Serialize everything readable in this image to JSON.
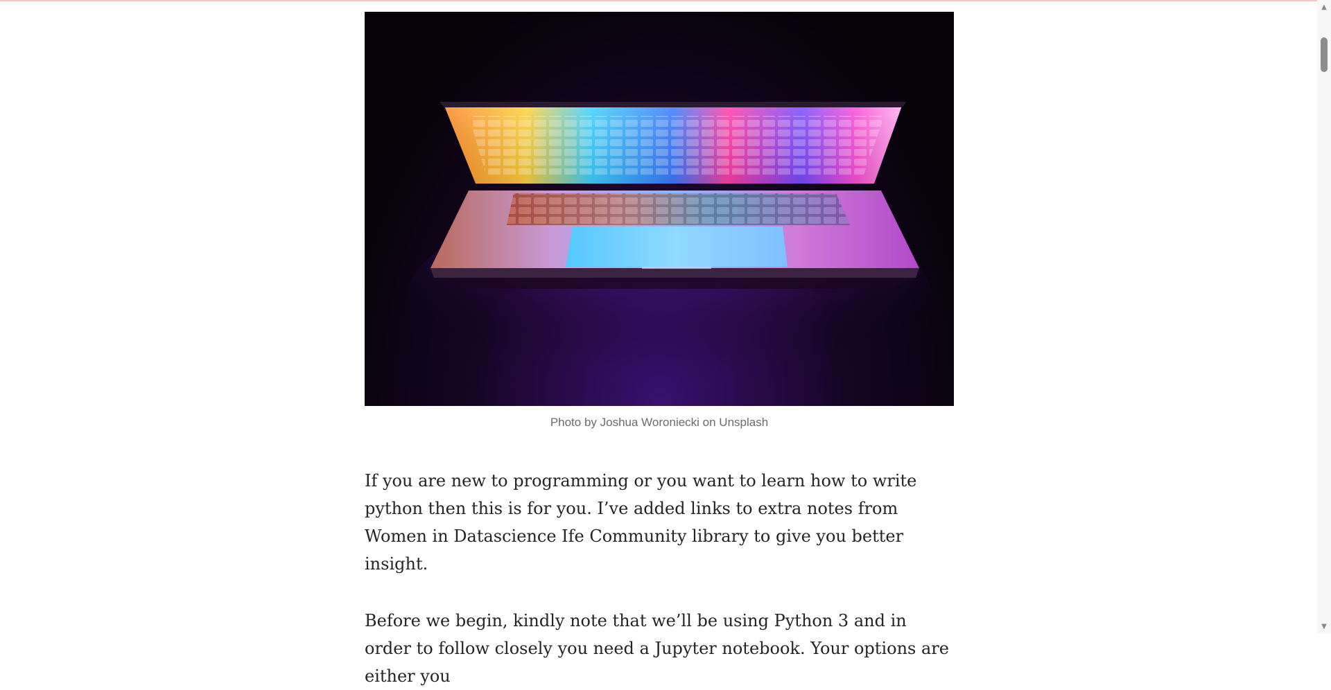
{
  "hero_image": {
    "alt": "Laptop glowing with colorful rainbow lights",
    "caption": "Photo by Joshua Woroniecki on Unsplash"
  },
  "article": {
    "paragraphs": [
      "If you are new to programming or you want to learn how to write python then this is for you. I’ve added links to extra notes from Women in Datascience Ife Community library to give you better insight.",
      "Before we begin, kindly note that we’ll be using Python 3 and in order to follow closely you need a Jupyter notebook. Your options are either you"
    ]
  },
  "scrollbar": {
    "up_icon": "triangle-up",
    "down_icon": "triangle-down"
  }
}
